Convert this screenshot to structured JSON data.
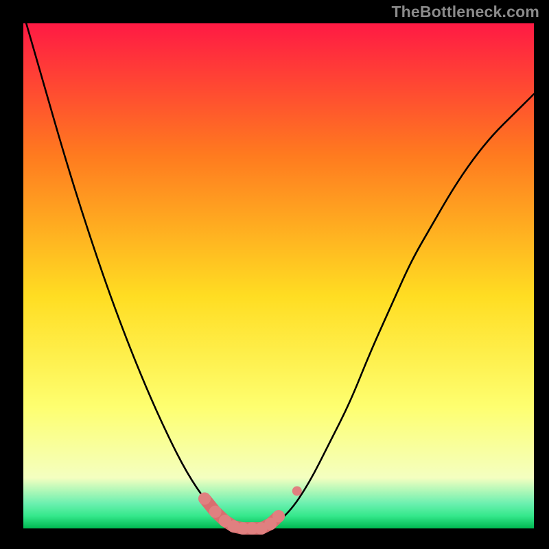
{
  "watermark": "TheBottleneck.com",
  "colors": {
    "frame": "#000000",
    "marker_fill": "#e08080",
    "marker_stroke": "#d86f6f",
    "curve": "#000000",
    "gradient_top": "#ff1a44",
    "gradient_upper": "#ff7a1f",
    "gradient_mid": "#ffdd22",
    "gradient_lower": "#feff70",
    "gradient_pale": "#f4ffc0",
    "gradient_green": "#24e57f",
    "gradient_band_light": "#6df0b0",
    "gradient_band_mid": "#35e88c",
    "gradient_bottom_green": "#00b851"
  },
  "chart_data": {
    "type": "line",
    "title": "",
    "x": [
      0.0,
      0.04,
      0.08,
      0.12,
      0.16,
      0.2,
      0.24,
      0.28,
      0.32,
      0.36,
      0.4,
      0.44,
      0.48,
      0.52,
      0.56,
      0.6,
      0.64,
      0.68,
      0.72,
      0.76,
      0.8,
      0.84,
      0.88,
      0.92,
      0.96,
      1.0
    ],
    "series": [
      {
        "name": "bottleneck-curve",
        "values": [
          1.02,
          0.88,
          0.74,
          0.61,
          0.49,
          0.38,
          0.28,
          0.19,
          0.11,
          0.05,
          0.01,
          0.0,
          0.0,
          0.03,
          0.09,
          0.17,
          0.25,
          0.35,
          0.44,
          0.53,
          0.6,
          0.67,
          0.73,
          0.78,
          0.82,
          0.86
        ]
      }
    ],
    "markers": [
      {
        "x": 0.355,
        "y": 0.059
      },
      {
        "x": 0.376,
        "y": 0.033
      },
      {
        "x": 0.395,
        "y": 0.015
      },
      {
        "x": 0.412,
        "y": 0.004
      },
      {
        "x": 0.43,
        "y": 0.0
      },
      {
        "x": 0.448,
        "y": 0.0
      },
      {
        "x": 0.466,
        "y": 0.0
      },
      {
        "x": 0.484,
        "y": 0.009
      },
      {
        "x": 0.5,
        "y": 0.024
      },
      {
        "x": 0.536,
        "y": 0.074
      }
    ],
    "xlim": [
      0,
      1
    ],
    "ylim": [
      0,
      1
    ],
    "xlabel": "",
    "ylabel": "",
    "grid": false,
    "legend": false
  }
}
